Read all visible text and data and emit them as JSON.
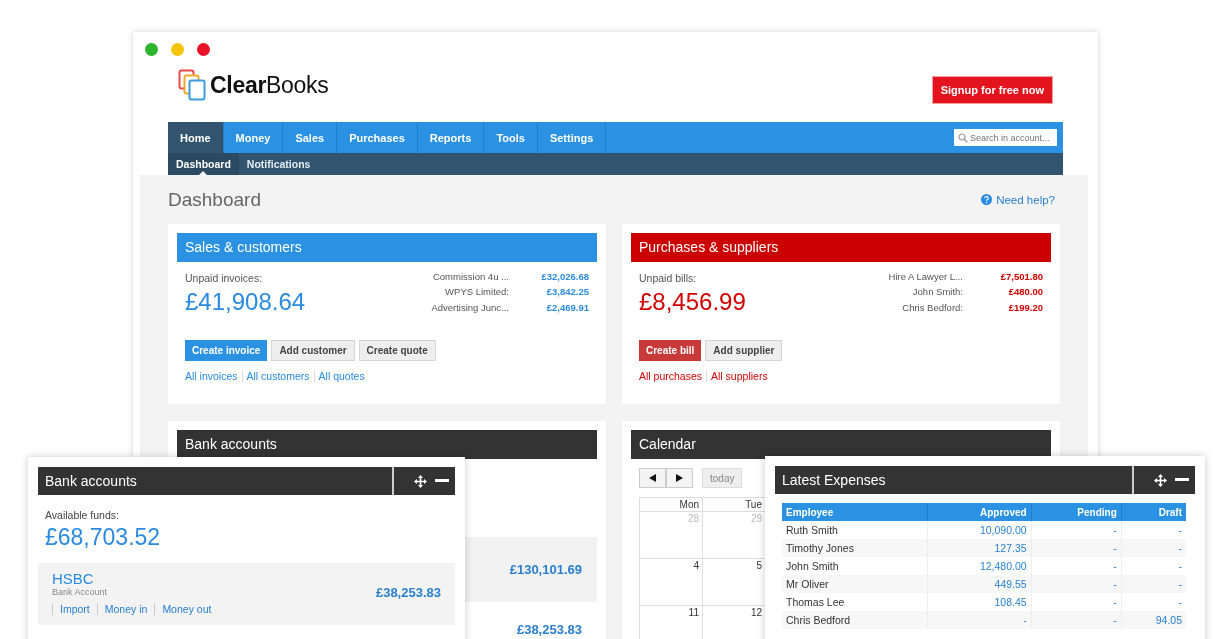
{
  "window": {
    "controls": [
      {
        "color": "#2db52d"
      },
      {
        "color": "#f5c400"
      },
      {
        "color": "#e8132a"
      }
    ]
  },
  "logo": "**Clear**Books",
  "signup_button": "Signup for free now",
  "nav": {
    "tabs": [
      {
        "label": "Home",
        "selected": true
      },
      {
        "label": "Money",
        "selected": false
      },
      {
        "label": "Sales",
        "selected": false
      },
      {
        "label": "Purchases",
        "selected": false
      },
      {
        "label": "Reports",
        "selected": false
      },
      {
        "label": "Tools",
        "selected": false
      },
      {
        "label": "Settings",
        "selected": false
      }
    ],
    "search": {
      "placeholder": "Search in account..."
    },
    "subtabs": [
      {
        "label": "Dashboard",
        "selected": true
      },
      {
        "label": "Notifications",
        "selected": false
      }
    ]
  },
  "page_title": "Dashboard",
  "help_link": "Need help?",
  "cards": [
    {
      "kind": "sales",
      "title": "Sales & customers",
      "summary_label": "Unpaid invoices:",
      "total": "£41,908.64",
      "items": [
        {
          "name": "Commission 4u ...",
          "amount": "£32,026.68"
        },
        {
          "name": "WPYS Limited:",
          "amount": "£3,842.25"
        },
        {
          "name": "Advertising Junc...",
          "amount": "£2,469.91"
        }
      ],
      "buttons": [
        {
          "label": "Create invoice",
          "primary": true
        },
        {
          "label": "Add customer",
          "primary": false
        },
        {
          "label": "Create quote",
          "primary": false
        }
      ],
      "links": [
        "All invoices",
        "All customers",
        "All quotes"
      ]
    },
    {
      "kind": "purchases",
      "title": "Purchases & suppliers",
      "summary_label": "Unpaid bills:",
      "total": "£8,456.99",
      "items": [
        {
          "name": "Hire A Lawyer L...",
          "amount": "£7,501.80"
        },
        {
          "name": "John Smith:",
          "amount": "£480.00"
        },
        {
          "name": "Chris Bedford:",
          "amount": "£199.20"
        }
      ],
      "buttons": [
        {
          "label": "Create bill",
          "primary": true
        },
        {
          "label": "Add supplier",
          "primary": false
        }
      ],
      "links": [
        "All purchases",
        "All suppliers"
      ]
    }
  ],
  "bank_card": {
    "title": "Bank accounts",
    "balances": [
      "£130,101.69",
      "£38,253.83"
    ]
  },
  "calendar": {
    "title": "Calendar",
    "today_button": "today",
    "days": [
      "Mon",
      "Tue"
    ],
    "weeks": [
      [
        {
          "day": "28",
          "outside_month": true
        },
        {
          "day": "29",
          "outside_month": true
        }
      ],
      [
        {
          "day": "4",
          "outside_month": false
        },
        {
          "day": "5",
          "outside_month": false
        }
      ],
      [
        {
          "day": "11",
          "outside_month": false
        },
        {
          "day": "12",
          "outside_month": false
        }
      ]
    ]
  },
  "bank_panel": {
    "title": "Bank accounts",
    "available_label": "Available funds:",
    "available": "£68,703.52",
    "accounts": [
      {
        "name": "HSBC",
        "type": "Bank Account",
        "balance": "£38,253.83",
        "links": [
          "Import",
          "Money in",
          "Money out"
        ]
      }
    ]
  },
  "expenses_panel": {
    "title": "Latest Expenses",
    "columns": [
      "Employee",
      "Approved",
      "Pending",
      "Draft"
    ],
    "rows": [
      [
        "Ruth Smith",
        "10,090.00",
        "-",
        "-"
      ],
      [
        "Timothy Jones",
        "127.35",
        "-",
        "-"
      ],
      [
        "John Smith",
        "12,480.00",
        "-",
        "-"
      ],
      [
        "Mr Oliver",
        "449.55",
        "-",
        "-"
      ],
      [
        "Thomas Lee",
        "108.45",
        "-",
        "-"
      ],
      [
        "Chris Bedford",
        "-",
        "-",
        "94.05"
      ]
    ]
  }
}
